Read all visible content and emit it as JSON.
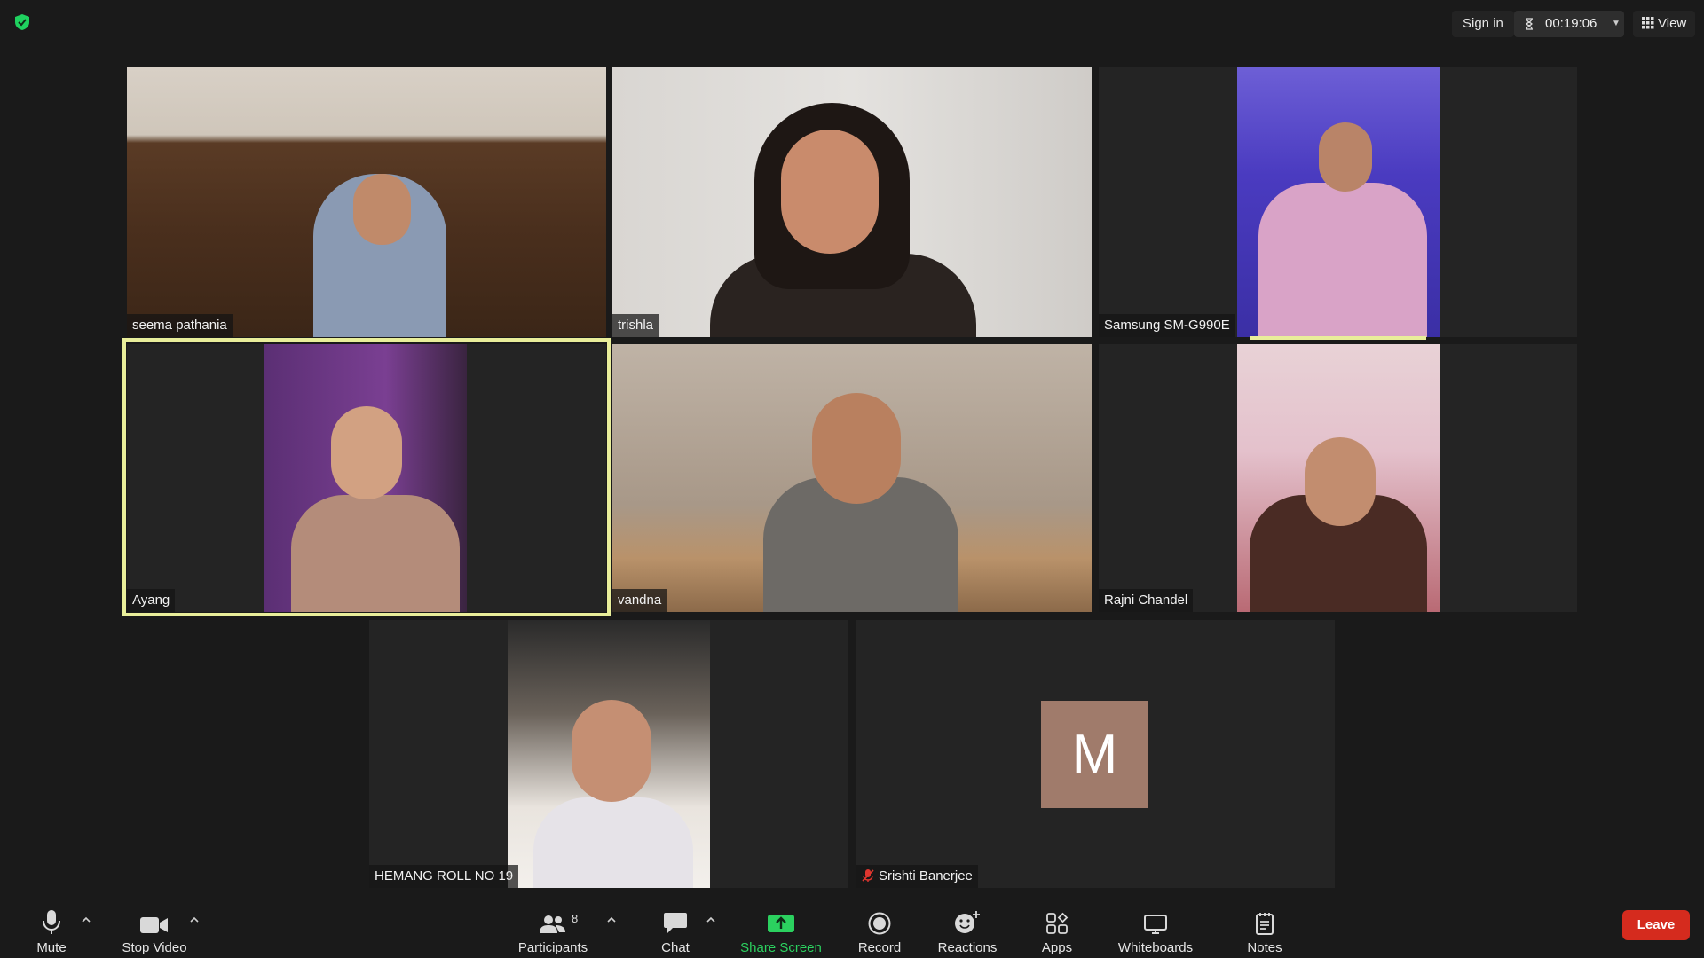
{
  "topbar": {
    "sign_in": "Sign in",
    "timer": "00:19:06",
    "view": "View",
    "security_color": "#1fd15f"
  },
  "participants": [
    {
      "name": "seema pathania",
      "mic_muted": false
    },
    {
      "name": "trishla",
      "mic_muted": false
    },
    {
      "name": "Samsung SM-G990E",
      "mic_muted": false
    },
    {
      "name": "Ayang",
      "mic_muted": false,
      "active_speaker": true
    },
    {
      "name": "vandna",
      "mic_muted": false
    },
    {
      "name": "Rajni Chandel",
      "mic_muted": false
    },
    {
      "name": "HEMANG ROLL NO 19",
      "mic_muted": false
    },
    {
      "name": "Srishti Banerjee",
      "mic_muted": true,
      "avatar_letter": "M",
      "avatar_color": "#a07b6b"
    }
  ],
  "toolbar": {
    "mute": "Mute",
    "stop_video": "Stop Video",
    "participants": "Participants",
    "participant_count": "8",
    "chat": "Chat",
    "share_screen": "Share Screen",
    "record": "Record",
    "reactions": "Reactions",
    "apps": "Apps",
    "whiteboards": "Whiteboards",
    "notes": "Notes",
    "leave": "Leave",
    "share_color": "#2bd15f",
    "leave_color": "#d52b1e",
    "active_speaker_color": "#e9ee9a"
  }
}
